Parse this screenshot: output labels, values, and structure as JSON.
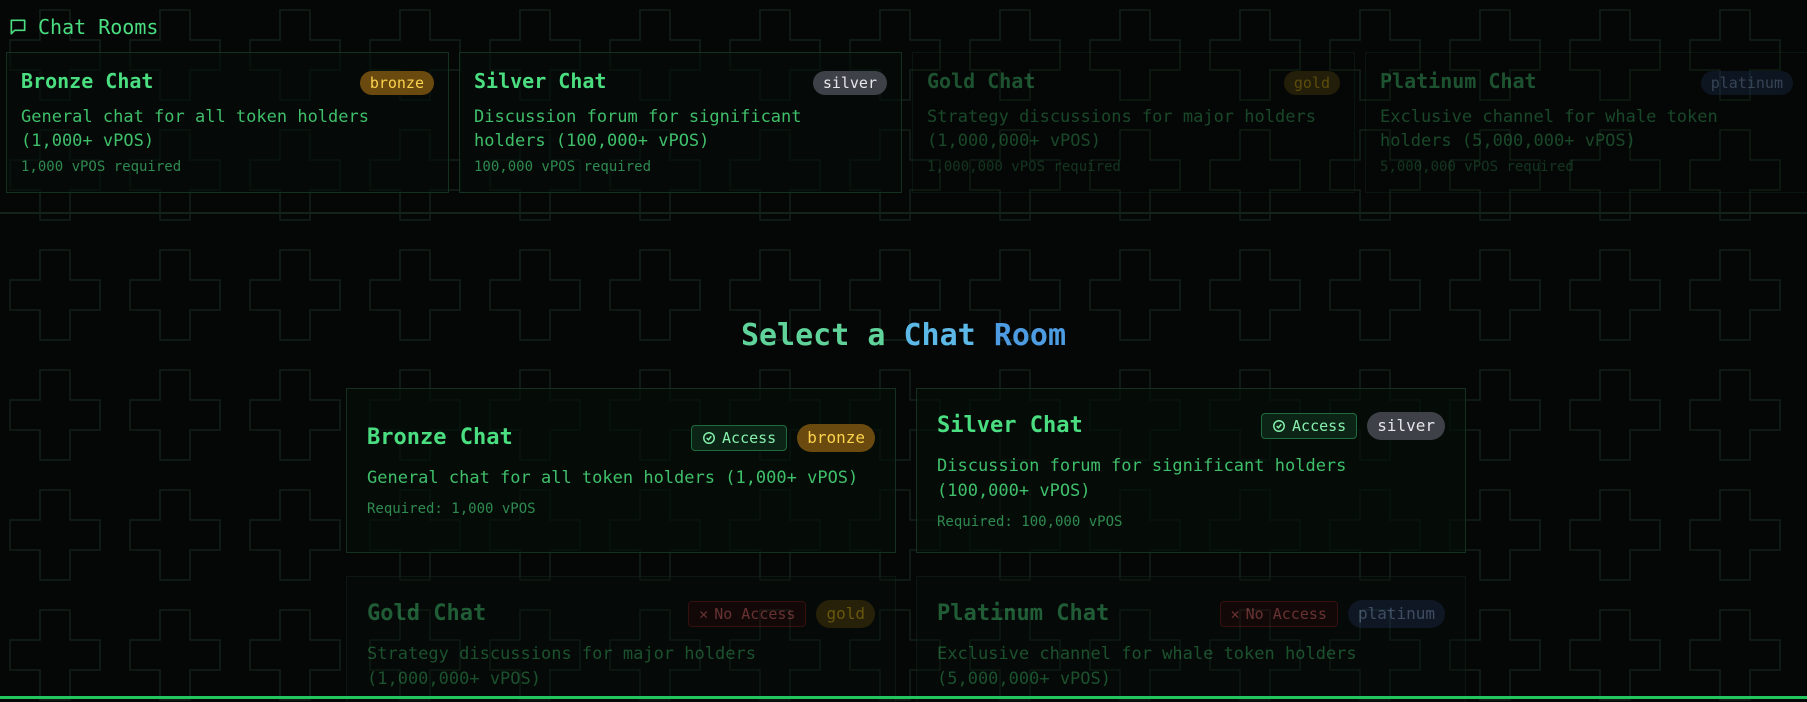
{
  "header": {
    "title": "Chat Rooms",
    "icon": "message-square-icon"
  },
  "rooms": [
    {
      "title": "Bronze Chat",
      "tier": "bronze",
      "desc": "General chat for all token holders (1,000+ vPOS)",
      "required": "1,000 vPOS required",
      "required_label": "Required: 1,000 vPOS",
      "access": "Access",
      "has_access": true
    },
    {
      "title": "Silver Chat",
      "tier": "silver",
      "desc": "Discussion forum for significant holders (100,000+ vPOS)",
      "required": "100,000 vPOS required",
      "required_label": "Required: 100,000 vPOS",
      "access": "Access",
      "has_access": true
    },
    {
      "title": "Gold Chat",
      "tier": "gold",
      "desc": "Strategy discussions for major holders (1,000,000+ vPOS)",
      "required": "1,000,000 vPOS required",
      "access": "No Access",
      "has_access": false
    },
    {
      "title": "Platinum Chat",
      "tier": "platinum",
      "desc": "Exclusive channel for whale token holders (5,000,000+ vPOS)",
      "required": "5,000,000 vPOS required",
      "access": "No Access",
      "has_access": false
    }
  ],
  "select": {
    "word1": "Select a",
    "word2": "Chat",
    "word3": "Room"
  },
  "colors": {
    "accent": "#4ade80",
    "bronze": "#fcd34d",
    "silver": "#e5e7eb",
    "gold": "#facc15",
    "platinum": "#93b4e8"
  }
}
